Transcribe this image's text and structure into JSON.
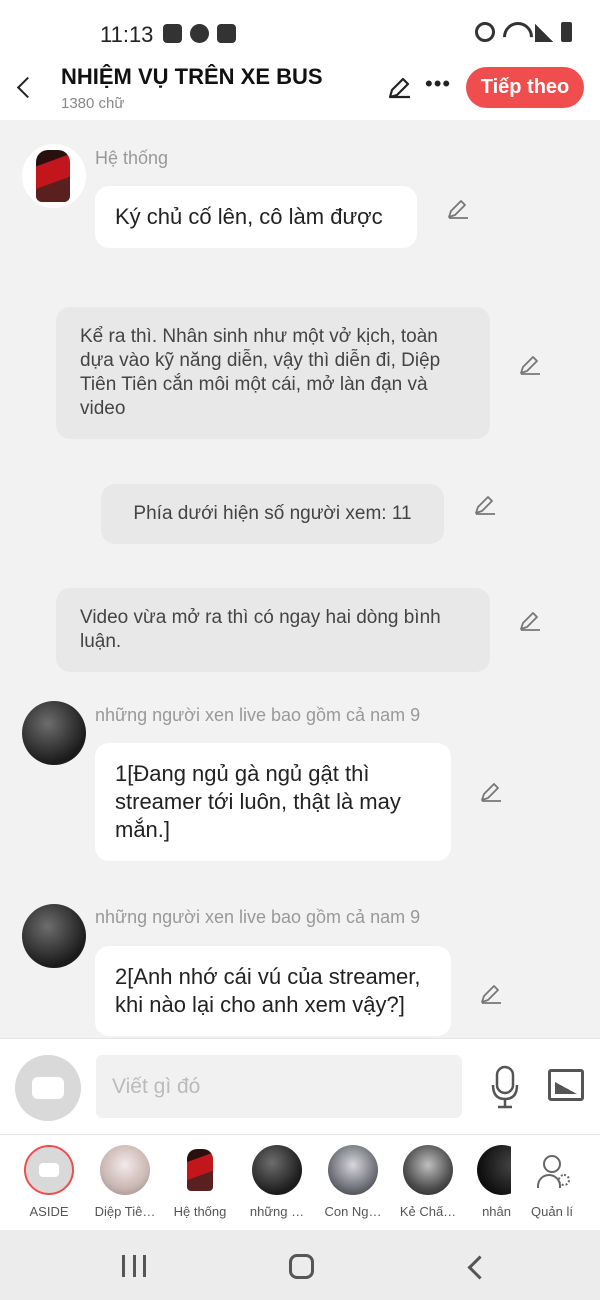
{
  "status_bar": {
    "time": "11:13"
  },
  "header": {
    "title": "NHIỆM VỤ TRÊN XE BUS",
    "subtitle": "1380 chữ",
    "next_label": "Tiếp theo"
  },
  "messages": [
    {
      "type": "character",
      "sender": "Hệ thống",
      "text": "Ký chủ cố lên, cô làm được"
    },
    {
      "type": "narration",
      "text": "Kể ra thì. Nhân sinh như một vở kịch, toàn dựa vào kỹ năng diễn, vậy thì diễn đi, Diệp Tiên Tiên cắn môi một cái, mở làn đạn và video"
    },
    {
      "type": "narration",
      "text": "Phía dưới hiện số người xem: 11"
    },
    {
      "type": "narration",
      "text": "Video vừa mở ra thì có ngay hai dòng bình luận."
    },
    {
      "type": "character",
      "sender": "những người xen live bao gồm cả nam 9",
      "text": "1[Đang ngủ gà ngủ gật thì streamer tới luôn, thật là may mắn.]"
    },
    {
      "type": "character",
      "sender": "những người xen live bao gồm cả nam 9",
      "text": "2[Anh nhớ cái vú của streamer, khi nào lại cho anh xem vậy?]"
    }
  ],
  "input": {
    "placeholder": "Viết gì đó"
  },
  "characters": [
    {
      "label": "ASIDE"
    },
    {
      "label": "Diệp Tiê…"
    },
    {
      "label": "Hệ thống"
    },
    {
      "label": "những …"
    },
    {
      "label": "Con Ng…"
    },
    {
      "label": "Kẻ Chấ…"
    },
    {
      "label": "nhân"
    }
  ],
  "manage_label": "Quản lí"
}
